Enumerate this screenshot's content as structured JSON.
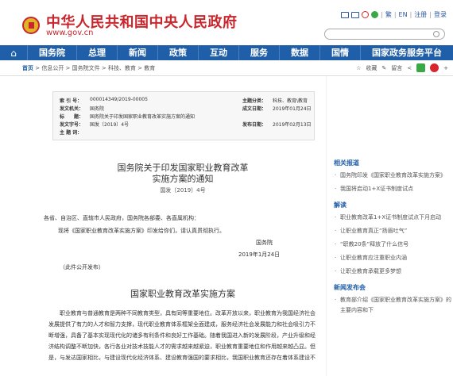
{
  "site": {
    "name": "中华人民共和国中央人民政府",
    "url": "www.gov.cn"
  },
  "toplinks": {
    "items": [
      "繁",
      "EN",
      "注册",
      "登录"
    ]
  },
  "nav": {
    "items": [
      "国务院",
      "总理",
      "新闻",
      "政策",
      "互动",
      "服务",
      "数据",
      "国情",
      "国家政务服务平台"
    ]
  },
  "breadcrumb": {
    "home": "首页",
    "path": " > 信息公开 > 国务院文件 > 科技、教育 > 教育"
  },
  "share": {
    "fav": "收藏",
    "leave": "留言"
  },
  "meta": {
    "rows": [
      {
        "k": "索 引 号：",
        "v": "000014349/2019-00005",
        "k2": "主题分类：",
        "v2": "科技、教育\\教育"
      },
      {
        "k": "发文机关：",
        "v": "国务院",
        "k2": "成文日期：",
        "v2": "2019年01月24日"
      },
      {
        "k": "标　　题：",
        "v": "国务院关于印发国家职业教育改革实施方案的通知",
        "k2": "",
        "v2": ""
      },
      {
        "k": "发文字号：",
        "v": "国发〔2019〕4号",
        "k2": "发布日期：",
        "v2": "2019年02月13日"
      },
      {
        "k": "主 题 词：",
        "v": "",
        "k2": "",
        "v2": ""
      }
    ]
  },
  "doc": {
    "title1": "国务院关于印发国家职业教育改革",
    "title2": "实施方案的通知",
    "docno": "国发〔2019〕4号",
    "addressee": "各省、自治区、直辖市人民政府，国务院各部委、各直属机构：",
    "intro": "现将《国家职业教育改革实施方案》印发给你们，请认真贯彻执行。",
    "sign": "国务院",
    "date": "2019年1月24日",
    "public": "（此件公开发布）",
    "plan_title": "国家职业教育改革实施方案",
    "body": "职业教育与普通教育是两种不同教育类型，具有同等重要地位。改革开放以来，职业教育为我国经济社会发展提供了有力的人才和智力支撑，现代职业教育体系框架全面建成，服务经济社会发展能力和社会吸引力不断增强，具备了基本实现现代化的诸多有利条件和良好工作基础。随着我国进入新的发展阶段，产业升级和经济结构调整不断加快，各行各业对技术技能人才的需求越来越紧迫，职业教育重要地位和作用越来越凸显。但是，与发达国家相比，与建设现代化经济体系、建设教育强国的要求相比，我国职业教育还存在着体系建设不"
  },
  "side": {
    "sections": [
      {
        "head": "相关报道",
        "items": [
          "国务院印发《国家职业教育改革实施方案》",
          "我国将启动1+X证书制度试点"
        ]
      },
      {
        "head": "解读",
        "items": [
          "职业教育改革1+X证书制度试点下月启动",
          "让职业教育真正“扬眉吐气”",
          "“职教20条”释放了什么信号",
          "让职业教育应注重职业内涵",
          "让职业教育承载更多梦想"
        ]
      },
      {
        "head": "新闻发布会",
        "items": [
          "教育部介绍《国家职业教育改革实施方案》的主要内容和下"
        ]
      }
    ]
  },
  "colors": {
    "brand_red": "#c8262c",
    "nav_blue": "#1f5ea8"
  }
}
